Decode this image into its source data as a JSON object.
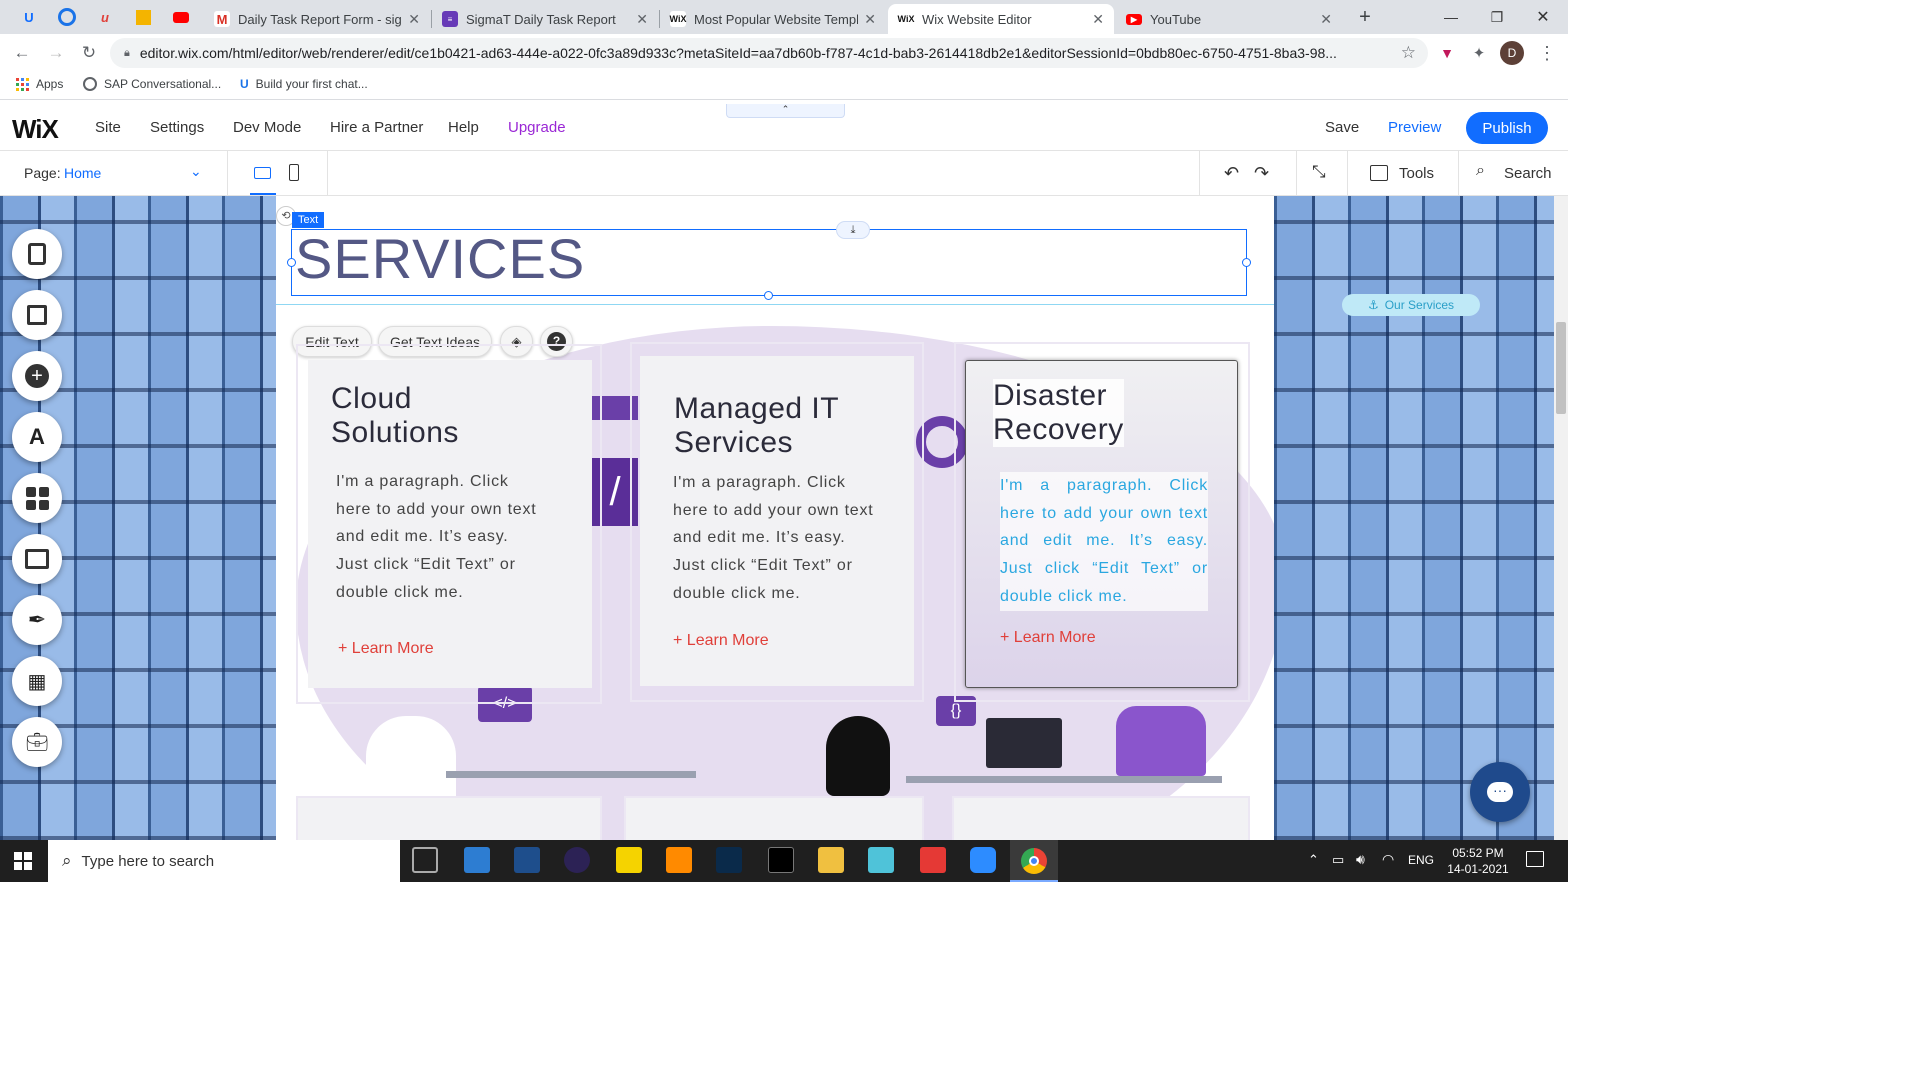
{
  "browser": {
    "tabs": [
      {
        "title": "Daily Task Report Form - sigm",
        "icon": "gmail-icon"
      },
      {
        "title": "SigmaT Daily Task Report",
        "icon": "forms-icon"
      },
      {
        "title": "Most Popular Website Templa",
        "icon": "wix-icon"
      },
      {
        "title": "Wix Website Editor",
        "icon": "wix-icon",
        "active": true
      },
      {
        "title": "YouTube",
        "icon": "youtube-icon"
      }
    ],
    "url": "editor.wix.com/html/editor/web/renderer/edit/ce1b0421-ad63-444e-a022-0fc3a89d933c?metaSiteId=aa7db60b-f787-4c1d-bab3-2614418db2e1&editorSessionId=0bdb80ec-6750-4751-8ba3-98...",
    "profile_initial": "D",
    "bookmarks": [
      "Apps",
      "SAP Conversational...",
      "Build your first chat..."
    ]
  },
  "editor": {
    "logo": "WiX",
    "menu": [
      "Site",
      "Settings",
      "Dev Mode",
      "Hire a Partner",
      "Help"
    ],
    "upgrade": "Upgrade",
    "save": "Save",
    "preview": "Preview",
    "publish": "Publish",
    "page_label": "Page:",
    "page_value": "Home",
    "tools": "Tools",
    "search": "Search"
  },
  "canvas": {
    "text_tag": "Text",
    "heading": "SERVICES",
    "anchor": "Our Services",
    "edit_text": "Edit Text",
    "get_text_ideas": "Get Text Ideas",
    "cards": [
      {
        "title_1": "Cloud",
        "title_2": "Solutions",
        "para": "I'm a paragraph. Click here to add your own text and edit me. It’s easy. Just click “Edit Text” or double click me.",
        "link": "+ Learn More"
      },
      {
        "title_1": "Managed IT",
        "title_2": "Services",
        "para": "I'm a paragraph. Click here to add your own text and edit me. It’s easy. Just click “Edit Text” or double click me.",
        "link": "+ Learn More"
      },
      {
        "title_1": "Disaster",
        "title_2": "Recovery",
        "para": "I'm a paragraph. Click here to add your own text and edit me. It’s easy. Just click “Edit Text” or double click me.",
        "link": "+ Learn More"
      }
    ]
  },
  "taskbar": {
    "search_placeholder": "Type here to search",
    "lang": "ENG",
    "time": "05:52 PM",
    "date": "14-01-2021"
  },
  "colors": {
    "accent": "#116dff",
    "upgrade": "#9a27d5",
    "link_red": "#e0403a",
    "purple": "#6a3fa8"
  }
}
